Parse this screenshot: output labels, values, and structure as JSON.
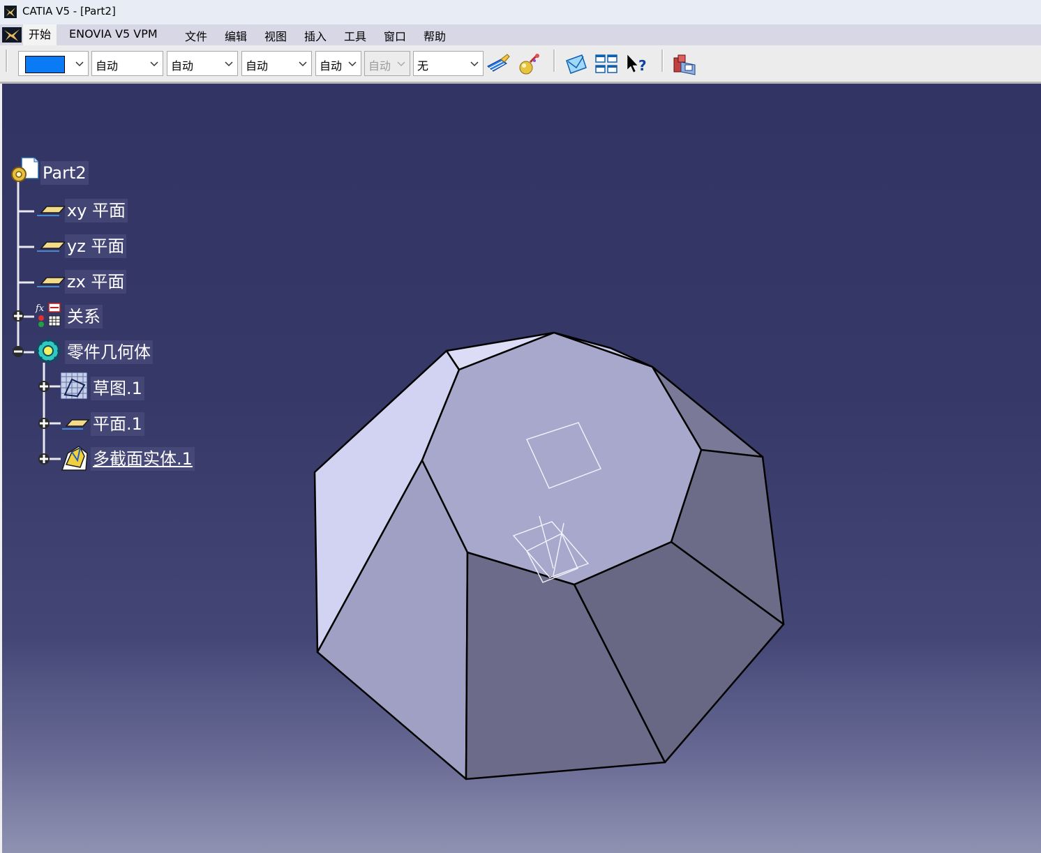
{
  "window": {
    "title": "CATIA V5 - [Part2]"
  },
  "menu": {
    "items": [
      "开始",
      "ENOVIA V5 VPM",
      "文件",
      "编辑",
      "视图",
      "插入",
      "工具",
      "窗口",
      "帮助"
    ],
    "active": "开始"
  },
  "toolbar": {
    "color_value": "#0a7af5",
    "combos": [
      {
        "value": "自动",
        "enabled": true
      },
      {
        "value": "自动",
        "enabled": true
      },
      {
        "value": "自动",
        "enabled": true
      },
      {
        "value": "自动",
        "enabled": true
      },
      {
        "value": "自动",
        "enabled": false
      },
      {
        "value": "无",
        "enabled": true
      }
    ],
    "icons": [
      "painter-icon",
      "apply-material-icon",
      "swap-visible-space-icon",
      "tile-windows-icon",
      "whats-this-help-icon",
      "catalog-browser-icon"
    ]
  },
  "tree": {
    "root": "Part2",
    "nodes": [
      {
        "label": "xy 平面",
        "icon": "plane-icon",
        "expander": "none"
      },
      {
        "label": "yz 平面",
        "icon": "plane-icon",
        "expander": "none"
      },
      {
        "label": "zx 平面",
        "icon": "plane-icon",
        "expander": "none"
      },
      {
        "label": "关系",
        "icon": "relations-icon",
        "expander": "plus"
      },
      {
        "label": "零件几何体",
        "icon": "body-gear-icon",
        "expander": "minus"
      }
    ],
    "children": [
      {
        "label": "草图.1",
        "icon": "sketch-icon",
        "expander": "plus"
      },
      {
        "label": "平面.1",
        "icon": "plane-icon",
        "expander": "plus"
      },
      {
        "label": "多截面实体.1",
        "icon": "multi-section-solid-icon",
        "expander": "plus",
        "selected": true
      }
    ]
  },
  "colors": {
    "viewport_top": "#323464",
    "viewport_bottom": "#9092b2",
    "solid_light": "#d0d0f0",
    "solid_dark": "#656580"
  }
}
